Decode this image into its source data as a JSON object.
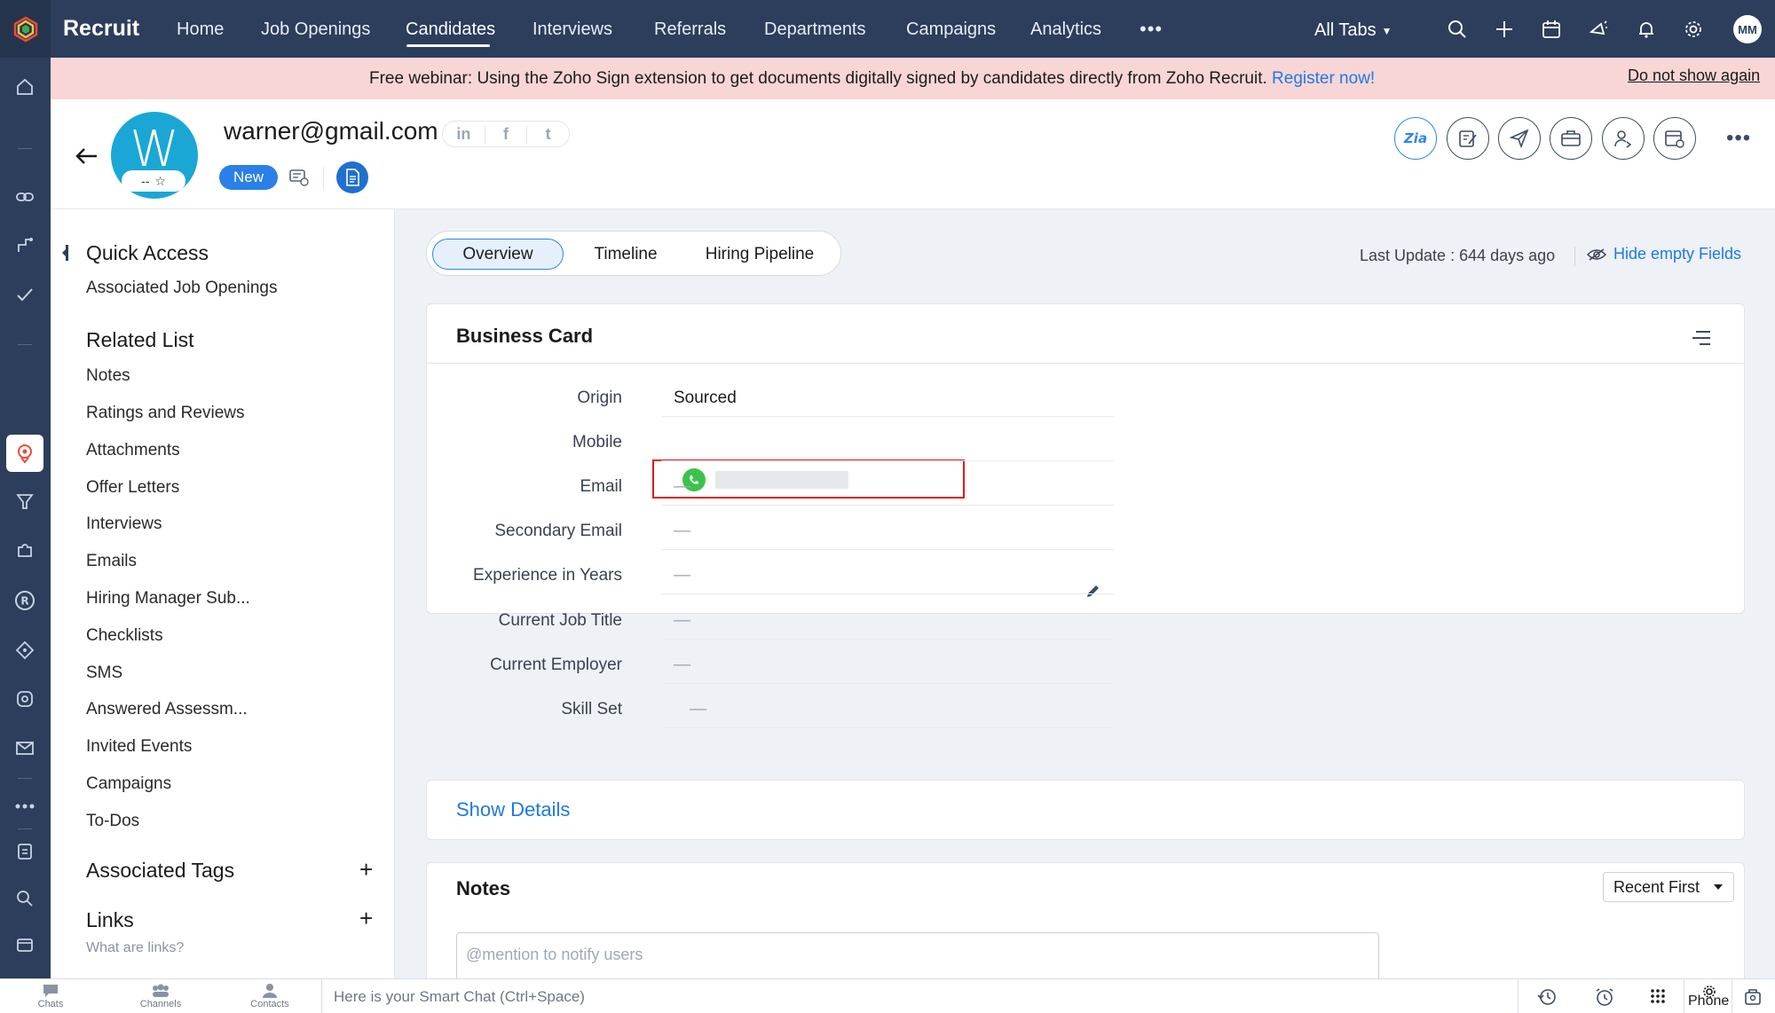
{
  "app": {
    "brand": "Recruit"
  },
  "nav": {
    "items": [
      "Home",
      "Job Openings",
      "Candidates",
      "Interviews",
      "Referrals",
      "Departments",
      "Campaigns",
      "Analytics"
    ],
    "active": "Candidates",
    "more": "•••",
    "all_tabs": "All Tabs",
    "user_initials": "MM"
  },
  "banner": {
    "text": "Free webinar: Using the Zoho Sign extension to get documents digitally signed by candidates directly from Zoho Recruit.",
    "link": "Register now!",
    "dismiss": "Do not show again"
  },
  "candidate": {
    "avatar_letter": "W",
    "rating": "--",
    "star": "☆",
    "email": "warner@gmail.com",
    "status": "New",
    "social": [
      "in",
      "f",
      "t"
    ]
  },
  "left_panel": {
    "quick_access": {
      "title": "Quick Access",
      "items": [
        "Associated Job Openings"
      ]
    },
    "related_list": {
      "title": "Related List",
      "items": [
        "Notes",
        "Ratings and Reviews",
        "Attachments",
        "Offer Letters",
        "Interviews",
        "Emails",
        "Hiring Manager Sub...",
        "Checklists",
        "SMS",
        "Answered Assessm...",
        "Invited Events",
        "Campaigns",
        "To-Dos"
      ]
    },
    "associated_tags": {
      "title": "Associated Tags",
      "plus": "+"
    },
    "links": {
      "title": "Links",
      "plus": "+",
      "hint": "What are links?"
    }
  },
  "main": {
    "tabs": [
      "Overview",
      "Timeline",
      "Hiring Pipeline"
    ],
    "active_tab": "Overview",
    "last_update": "Last Update : 644 days ago",
    "hide_empty": "Hide empty Fields",
    "business_card": {
      "title": "Business Card",
      "fields": [
        {
          "label": "Origin",
          "value": "Sourced"
        },
        {
          "label": "Mobile",
          "value": ""
        },
        {
          "label": "Email",
          "value": "—"
        },
        {
          "label": "Secondary Email",
          "value": "—"
        },
        {
          "label": "Experience in Years",
          "value": "—"
        },
        {
          "label": "Current Job Title",
          "value": "—"
        },
        {
          "label": "Current Employer",
          "value": "—"
        },
        {
          "label": "Skill Set",
          "value": "—"
        }
      ]
    },
    "show_details": "Show Details",
    "notes": {
      "title": "Notes",
      "sort": "Recent First",
      "placeholder": "@mention to notify users"
    }
  },
  "bottom_bar": {
    "tabs": [
      "Chats",
      "Channels",
      "Contacts"
    ],
    "smartchat": "Here is your Smart Chat (Ctrl+Space)",
    "phone_label": "Phone"
  },
  "colors": {
    "nav_bg": "#2c3e5c",
    "banner_bg": "#f7d6d5",
    "accent": "#1e79e5",
    "status_badge": "#2a80e8",
    "avatar": "#1aa7d5",
    "highlight": "#e11b1b",
    "whatsapp": "#3cc24b"
  }
}
